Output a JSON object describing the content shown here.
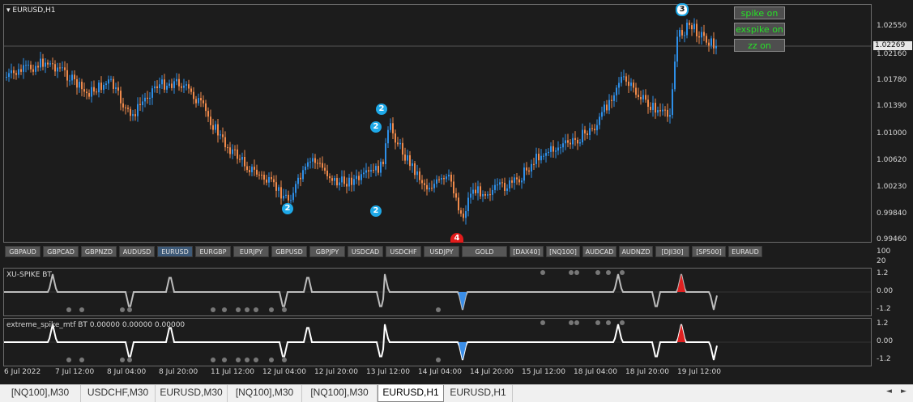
{
  "chart": {
    "title": "EURUSD,H1",
    "price_axis": [
      "1.02550",
      "1.02160",
      "1.01780",
      "1.01390",
      "1.01000",
      "1.00620",
      "1.00230",
      "0.99840",
      "0.99460"
    ],
    "current_price": "1.02269",
    "time_axis": [
      "6 Jul 2022",
      "7 Jul 12:00",
      "8 Jul 04:00",
      "8 Jul 20:00",
      "11 Jul 12:00",
      "12 Jul 04:00",
      "12 Jul 20:00",
      "13 Jul 12:00",
      "14 Jul 04:00",
      "14 Jul 20:00",
      "15 Jul 12:00",
      "18 Jul 04:00",
      "18 Jul 20:00",
      "19 Jul 12:00"
    ],
    "colors": {
      "bull": "#2e8fe8",
      "bear": "#f08a4b",
      "background": "#1c1c1c",
      "badge": "#1ea9e8"
    },
    "markers": {
      "badge_2": "2",
      "badge_3": "3",
      "badge_4": "4"
    }
  },
  "toggles": {
    "spike": "spike on",
    "exspike": "exspike on",
    "zz": "zz on"
  },
  "symbols": [
    "GBPAUD",
    "GBPCAD",
    "GBPNZD",
    "AUDUSD",
    "EURUSD",
    "EURGBP",
    "EURJPY",
    "GBPUSD",
    "GBPJPY",
    "USDCAD",
    "USDCHF",
    "USDJPY",
    "GOLD",
    "[DAX40]",
    "[NQ100]",
    "AUDCAD",
    "AUDNZD",
    "[DJI30]",
    "[SP500]",
    "EURAUD"
  ],
  "active_symbol": "EURUSD",
  "button_axis": [
    "100",
    "20"
  ],
  "indicator1": {
    "label": "XU-SPIKE BT",
    "axis": [
      "1.2",
      "0.00",
      "-1.2"
    ]
  },
  "indicator2": {
    "label": "extreme_spike_mtf BT 0.00000 0.00000 0.00000",
    "axis": [
      "1.2",
      "0.00",
      "-1.2"
    ]
  },
  "tabs": [
    "[NQ100],M30",
    "USDCHF,M30",
    "EURUSD,M30",
    "[NQ100],M30",
    "[NQ100],M30",
    "EURUSD,H1",
    "EURUSD,H1"
  ],
  "active_tab": 5,
  "tab_scroll": {
    "left": "◄",
    "right": "►"
  }
}
